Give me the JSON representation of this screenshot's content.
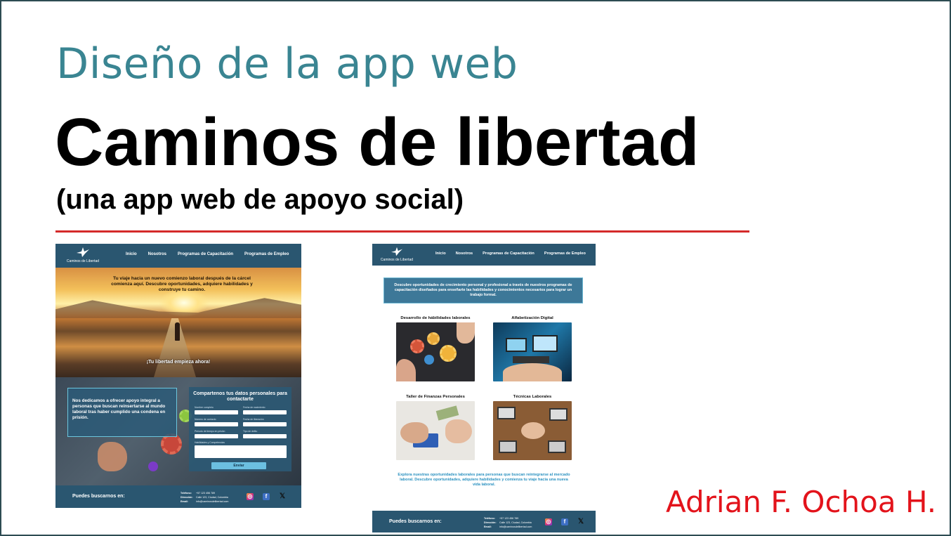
{
  "slide": {
    "subtitle": "Diseño de la app web",
    "title": "Caminos de libertad",
    "tagline": "(una app web de apoyo social)",
    "author": "Adrian F. Ochoa H.",
    "colors": {
      "subtitle": "#3a8592",
      "rule": "#d42a2a",
      "author": "#e3131b",
      "border": "#2d4b52"
    }
  },
  "site": {
    "logo_text": "Caminos de Libertad",
    "nav": [
      "Inicio",
      "Nosotros",
      "Programas de Capacitación",
      "Programas de Empleo"
    ],
    "footer": {
      "label": "Puedes buscarnos en:",
      "phone_label": "Teléfono:",
      "phone": "+57 123 456 789",
      "address_label": "Dirección:",
      "address": "Calle 123, Ciudad, Colombia",
      "email_label": "Email:",
      "email": "info@caminosdelibertad.com",
      "social_icons": [
        "instagram-icon",
        "facebook-icon",
        "x-icon"
      ]
    },
    "colors": {
      "nav": "#2a5670",
      "accent": "#6cbfe0"
    }
  },
  "home": {
    "hero_text": "Tu viaje hacia un nuevo comienzo laboral después de la cárcel comienza aquí. Descubre oportunidades, adquiere habilidades y construye tu camino.",
    "hero_sub": "¡Tu libertad empieza ahora!",
    "info": "Nos dedicamos a ofrecer apoyo integral a personas que buscan reinsertarse al mundo laboral tras haber cumplido una condena en prisión.",
    "form": {
      "title": "Compartenos tus datos personales para contactarte",
      "fields": [
        "Nombre completo",
        "Fecha de nacimiento",
        "Número de contacto",
        "Fecha de liberación",
        "Período de tiempo en prisión",
        "Tipo de delito",
        "Habilidades y Competencias"
      ],
      "submit": "Enviar"
    }
  },
  "programs": {
    "intro": "Descubre oportunidades de crecimiento personal y profesional a través de nuestros programas de capacitación diseñados para enseñarte las habilidades y conocimientos necesarios para lograr un trabajo formal.",
    "cards": [
      {
        "title": "Desarrollo de hábilidades laborales",
        "image": "gears-hands"
      },
      {
        "title": "Alfabetización Digital",
        "image": "devices-hands"
      },
      {
        "title": "Taller de Finanzas Personales",
        "image": "calculator-money"
      },
      {
        "title": "Técnicas Laborales",
        "image": "team-laptops"
      }
    ],
    "closing": "Explora nuestras oportunidades laborales para personas que buscan reintegrarse al mercado laboral. Descubre oportunidades, adquiere habilidades y comienza tu viaje hacia una nueva vida laboral."
  }
}
